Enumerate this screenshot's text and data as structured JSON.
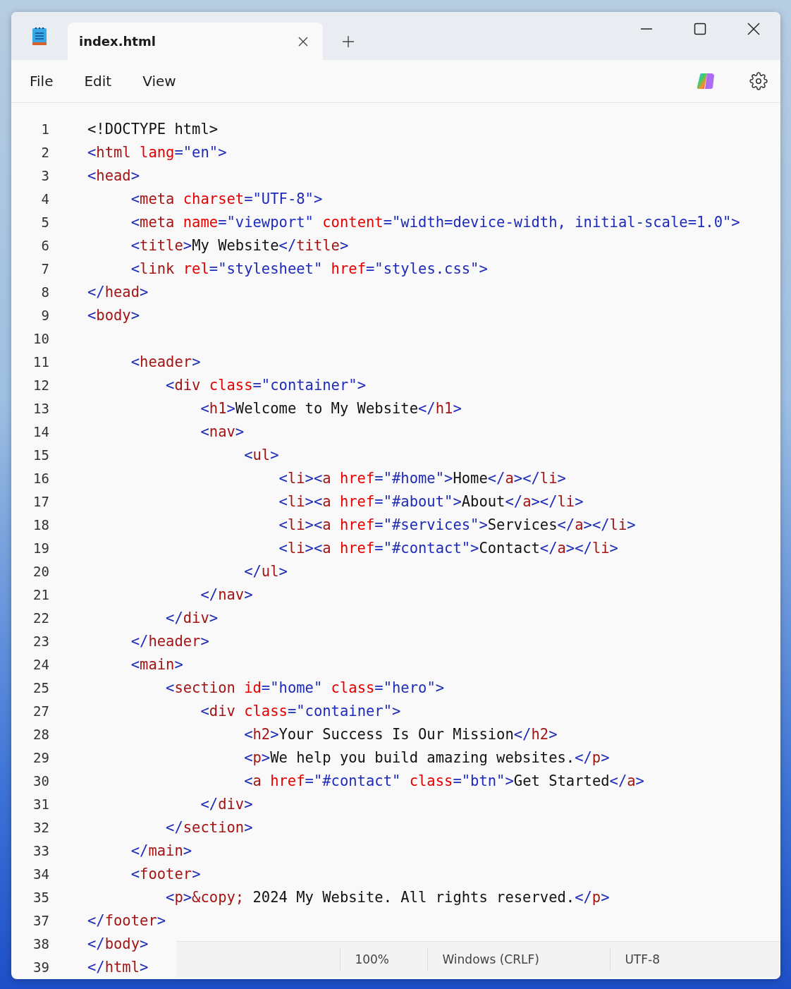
{
  "window": {
    "tab": {
      "title": "index.html",
      "selected": true
    }
  },
  "menu": [
    "File",
    "Edit",
    "View"
  ],
  "editor": {
    "lines": [
      {
        "number": "1",
        "tokens": [
          {
            "kind": "text",
            "text": "<!DOCTYPE html>"
          }
        ]
      },
      {
        "number": "2",
        "tokens": [
          {
            "kind": "punct",
            "text": "<"
          },
          {
            "kind": "tag",
            "text": "html"
          },
          {
            "kind": "attr",
            "text": " lang"
          },
          {
            "kind": "value",
            "text": "=\"en\""
          },
          {
            "kind": "punct",
            "text": ">"
          }
        ]
      },
      {
        "number": "3",
        "tokens": [
          {
            "kind": "punct",
            "text": "<"
          },
          {
            "kind": "tag",
            "text": "head"
          },
          {
            "kind": "punct",
            "text": ">"
          }
        ]
      },
      {
        "number": "4",
        "tokens": [
          {
            "kind": "punct",
            "text": "     <"
          },
          {
            "kind": "tag",
            "text": "meta"
          },
          {
            "kind": "attr",
            "text": " charset"
          },
          {
            "kind": "value",
            "text": "=\"UTF-8\""
          },
          {
            "kind": "punct",
            "text": ">"
          }
        ]
      },
      {
        "number": "5",
        "tokens": [
          {
            "kind": "punct",
            "text": "     <"
          },
          {
            "kind": "tag",
            "text": "meta"
          },
          {
            "kind": "attr",
            "text": " name"
          },
          {
            "kind": "value",
            "text": "=\"viewport\""
          },
          {
            "kind": "attr",
            "text": " content"
          },
          {
            "kind": "value",
            "text": "=\"width=device-width, initial-scale=1.0\""
          },
          {
            "kind": "punct",
            "text": ">"
          }
        ]
      },
      {
        "number": "6",
        "tokens": [
          {
            "kind": "punct",
            "text": "     <"
          },
          {
            "kind": "tag",
            "text": "title"
          },
          {
            "kind": "punct",
            "text": ">"
          },
          {
            "kind": "text",
            "text": "My Website"
          },
          {
            "kind": "punct",
            "text": "</"
          },
          {
            "kind": "tag",
            "text": "title"
          },
          {
            "kind": "punct",
            "text": ">"
          }
        ]
      },
      {
        "number": "7",
        "tokens": [
          {
            "kind": "punct",
            "text": "     <"
          },
          {
            "kind": "tag",
            "text": "link"
          },
          {
            "kind": "attr",
            "text": " rel"
          },
          {
            "kind": "value",
            "text": "=\"stylesheet\""
          },
          {
            "kind": "attr",
            "text": " href"
          },
          {
            "kind": "value",
            "text": "=\"styles.css\""
          },
          {
            "kind": "punct",
            "text": ">"
          }
        ]
      },
      {
        "number": "8",
        "tokens": [
          {
            "kind": "punct",
            "text": "</"
          },
          {
            "kind": "tag",
            "text": "head"
          },
          {
            "kind": "punct",
            "text": ">"
          }
        ]
      },
      {
        "number": "9",
        "tokens": [
          {
            "kind": "punct",
            "text": "<"
          },
          {
            "kind": "tag",
            "text": "body"
          },
          {
            "kind": "punct",
            "text": ">"
          }
        ]
      },
      {
        "number": "10"
      },
      {
        "number": "11",
        "tokens": [
          {
            "kind": "punct",
            "text": "     <"
          },
          {
            "kind": "tag",
            "text": "header"
          },
          {
            "kind": "punct",
            "text": ">"
          }
        ]
      },
      {
        "number": "12",
        "tokens": [
          {
            "kind": "punct",
            "text": "         <"
          },
          {
            "kind": "tag",
            "text": "div"
          },
          {
            "kind": "attr",
            "text": " class"
          },
          {
            "kind": "value",
            "text": "=\"container\""
          },
          {
            "kind": "punct",
            "text": ">"
          }
        ]
      },
      {
        "number": "13",
        "tokens": [
          {
            "kind": "punct",
            "text": "             <"
          },
          {
            "kind": "tag",
            "text": "h1"
          },
          {
            "kind": "punct",
            "text": ">"
          },
          {
            "kind": "text",
            "text": "Welcome to My Website"
          },
          {
            "kind": "punct",
            "text": "</"
          },
          {
            "kind": "tag",
            "text": "h1"
          },
          {
            "kind": "punct",
            "text": ">"
          }
        ]
      },
      {
        "number": "14",
        "tokens": [
          {
            "kind": "punct",
            "text": "             <"
          },
          {
            "kind": "tag",
            "text": "nav"
          },
          {
            "kind": "punct",
            "text": ">"
          }
        ]
      },
      {
        "number": "15",
        "tokens": [
          {
            "kind": "punct",
            "text": "                  <"
          },
          {
            "kind": "tag",
            "text": "ul"
          },
          {
            "kind": "punct",
            "text": ">"
          }
        ]
      },
      {
        "number": "16",
        "tokens": [
          {
            "kind": "punct",
            "text": "                      <"
          },
          {
            "kind": "tag",
            "text": "li"
          },
          {
            "kind": "punct",
            "text": "><"
          },
          {
            "kind": "tag",
            "text": "a"
          },
          {
            "kind": "attr",
            "text": " href"
          },
          {
            "kind": "value",
            "text": "=\"#home\""
          },
          {
            "kind": "punct",
            "text": ">"
          },
          {
            "kind": "text",
            "text": "Home"
          },
          {
            "kind": "punct",
            "text": "</"
          },
          {
            "kind": "tag",
            "text": "a"
          },
          {
            "kind": "punct",
            "text": "></"
          },
          {
            "kind": "tag",
            "text": "li"
          },
          {
            "kind": "punct",
            "text": ">"
          }
        ]
      },
      {
        "number": "17",
        "tokens": [
          {
            "kind": "punct",
            "text": "                      <"
          },
          {
            "kind": "tag",
            "text": "li"
          },
          {
            "kind": "punct",
            "text": "><"
          },
          {
            "kind": "tag",
            "text": "a"
          },
          {
            "kind": "attr",
            "text": " href"
          },
          {
            "kind": "value",
            "text": "=\"#about\""
          },
          {
            "kind": "punct",
            "text": ">"
          },
          {
            "kind": "text",
            "text": "About"
          },
          {
            "kind": "punct",
            "text": "</"
          },
          {
            "kind": "tag",
            "text": "a"
          },
          {
            "kind": "punct",
            "text": "></"
          },
          {
            "kind": "tag",
            "text": "li"
          },
          {
            "kind": "punct",
            "text": ">"
          }
        ]
      },
      {
        "number": "18",
        "tokens": [
          {
            "kind": "punct",
            "text": "                      <"
          },
          {
            "kind": "tag",
            "text": "li"
          },
          {
            "kind": "punct",
            "text": "><"
          },
          {
            "kind": "tag",
            "text": "a"
          },
          {
            "kind": "attr",
            "text": " href"
          },
          {
            "kind": "value",
            "text": "=\"#services\""
          },
          {
            "kind": "punct",
            "text": ">"
          },
          {
            "kind": "text",
            "text": "Services"
          },
          {
            "kind": "punct",
            "text": "</"
          },
          {
            "kind": "tag",
            "text": "a"
          },
          {
            "kind": "punct",
            "text": "></"
          },
          {
            "kind": "tag",
            "text": "li"
          },
          {
            "kind": "punct",
            "text": ">"
          }
        ]
      },
      {
        "number": "19",
        "tokens": [
          {
            "kind": "punct",
            "text": "                      <"
          },
          {
            "kind": "tag",
            "text": "li"
          },
          {
            "kind": "punct",
            "text": "><"
          },
          {
            "kind": "tag",
            "text": "a"
          },
          {
            "kind": "attr",
            "text": " href"
          },
          {
            "kind": "value",
            "text": "=\"#contact\""
          },
          {
            "kind": "punct",
            "text": ">"
          },
          {
            "kind": "text",
            "text": "Contact"
          },
          {
            "kind": "punct",
            "text": "</"
          },
          {
            "kind": "tag",
            "text": "a"
          },
          {
            "kind": "punct",
            "text": "></"
          },
          {
            "kind": "tag",
            "text": "li"
          },
          {
            "kind": "punct",
            "text": ">"
          }
        ]
      },
      {
        "number": "20",
        "tokens": [
          {
            "kind": "punct",
            "text": "                  </"
          },
          {
            "kind": "tag",
            "text": "ul"
          },
          {
            "kind": "punct",
            "text": ">"
          }
        ]
      },
      {
        "number": "21",
        "tokens": [
          {
            "kind": "punct",
            "text": "             </"
          },
          {
            "kind": "tag",
            "text": "nav"
          },
          {
            "kind": "punct",
            "text": ">"
          }
        ]
      },
      {
        "number": "22",
        "tokens": [
          {
            "kind": "punct",
            "text": "         </"
          },
          {
            "kind": "tag",
            "text": "div"
          },
          {
            "kind": "punct",
            "text": ">"
          }
        ]
      },
      {
        "number": "23",
        "tokens": [
          {
            "kind": "punct",
            "text": "     </"
          },
          {
            "kind": "tag",
            "text": "header"
          },
          {
            "kind": "punct",
            "text": ">"
          }
        ]
      },
      {
        "number": "24",
        "tokens": [
          {
            "kind": "punct",
            "text": "     <"
          },
          {
            "kind": "tag",
            "text": "main"
          },
          {
            "kind": "punct",
            "text": ">"
          }
        ]
      },
      {
        "number": "25",
        "tokens": [
          {
            "kind": "punct",
            "text": "         <"
          },
          {
            "kind": "tag",
            "text": "section"
          },
          {
            "kind": "attr",
            "text": " id"
          },
          {
            "kind": "value",
            "text": "=\"home\""
          },
          {
            "kind": "attr",
            "text": " class"
          },
          {
            "kind": "value",
            "text": "=\"hero\""
          },
          {
            "kind": "punct",
            "text": ">"
          }
        ]
      },
      {
        "number": "27",
        "tokens": [
          {
            "kind": "punct",
            "text": "             <"
          },
          {
            "kind": "tag",
            "text": "div"
          },
          {
            "kind": "attr",
            "text": " class"
          },
          {
            "kind": "value",
            "text": "=\"container\""
          },
          {
            "kind": "punct",
            "text": ">"
          }
        ]
      },
      {
        "number": "28",
        "tokens": [
          {
            "kind": "punct",
            "text": "                  <"
          },
          {
            "kind": "tag",
            "text": "h2"
          },
          {
            "kind": "punct",
            "text": ">"
          },
          {
            "kind": "text",
            "text": "Your Success Is Our Mission"
          },
          {
            "kind": "punct",
            "text": "</"
          },
          {
            "kind": "tag",
            "text": "h2"
          },
          {
            "kind": "punct",
            "text": ">"
          }
        ]
      },
      {
        "number": "29",
        "tokens": [
          {
            "kind": "punct",
            "text": "                  <"
          },
          {
            "kind": "tag",
            "text": "p"
          },
          {
            "kind": "punct",
            "text": ">"
          },
          {
            "kind": "text",
            "text": "We help you build amazing websites."
          },
          {
            "kind": "punct",
            "text": "</"
          },
          {
            "kind": "tag",
            "text": "p"
          },
          {
            "kind": "punct",
            "text": ">"
          }
        ]
      },
      {
        "number": "30",
        "tokens": [
          {
            "kind": "punct",
            "text": "                  <"
          },
          {
            "kind": "tag",
            "text": "a"
          },
          {
            "kind": "attr",
            "text": " href"
          },
          {
            "kind": "value",
            "text": "=\"#contact\""
          },
          {
            "kind": "attr",
            "text": " class"
          },
          {
            "kind": "value",
            "text": "=\"btn\""
          },
          {
            "kind": "punct",
            "text": ">"
          },
          {
            "kind": "text",
            "text": "Get Started"
          },
          {
            "kind": "punct",
            "text": "</"
          },
          {
            "kind": "tag",
            "text": "a"
          },
          {
            "kind": "punct",
            "text": ">"
          }
        ]
      },
      {
        "number": "31",
        "tokens": [
          {
            "kind": "punct",
            "text": "             </"
          },
          {
            "kind": "tag",
            "text": "div"
          },
          {
            "kind": "punct",
            "text": ">"
          }
        ]
      },
      {
        "number": "32",
        "tokens": [
          {
            "kind": "punct",
            "text": "         </"
          },
          {
            "kind": "tag",
            "text": "section"
          },
          {
            "kind": "punct",
            "text": ">"
          }
        ]
      },
      {
        "number": "33",
        "tokens": [
          {
            "kind": "punct",
            "text": "     </"
          },
          {
            "kind": "tag",
            "text": "main"
          },
          {
            "kind": "punct",
            "text": ">"
          }
        ]
      },
      {
        "number": "34",
        "tokens": [
          {
            "kind": "punct",
            "text": "     <"
          },
          {
            "kind": "tag",
            "text": "footer"
          },
          {
            "kind": "punct",
            "text": ">"
          }
        ]
      },
      {
        "number": "35",
        "tokens": [
          {
            "kind": "punct",
            "text": "         <"
          },
          {
            "kind": "tag",
            "text": "p"
          },
          {
            "kind": "punct",
            "text": ">"
          },
          {
            "kind": "entity",
            "text": "&copy;"
          },
          {
            "kind": "text",
            "text": " 2024 My Website. All rights reserved."
          },
          {
            "kind": "punct",
            "text": "</"
          },
          {
            "kind": "tag",
            "text": "p"
          },
          {
            "kind": "punct",
            "text": ">"
          }
        ]
      },
      {
        "number": "37",
        "tokens": [
          {
            "kind": "punct",
            "text": "</"
          },
          {
            "kind": "tag",
            "text": "footer"
          },
          {
            "kind": "punct",
            "text": ">"
          }
        ]
      },
      {
        "number": "38",
        "tokens": [
          {
            "kind": "punct",
            "text": "</"
          },
          {
            "kind": "tag",
            "text": "body"
          },
          {
            "kind": "punct",
            "text": ">"
          }
        ]
      },
      {
        "number": "39",
        "tokens": [
          {
            "kind": "punct",
            "text": "</"
          },
          {
            "kind": "tag",
            "text": "html"
          },
          {
            "kind": "punct",
            "text": ">"
          }
        ]
      }
    ]
  },
  "status_bar": {
    "zoom": "100%",
    "line_ending": "Windows (CRLF)",
    "encoding": "UTF-8"
  }
}
